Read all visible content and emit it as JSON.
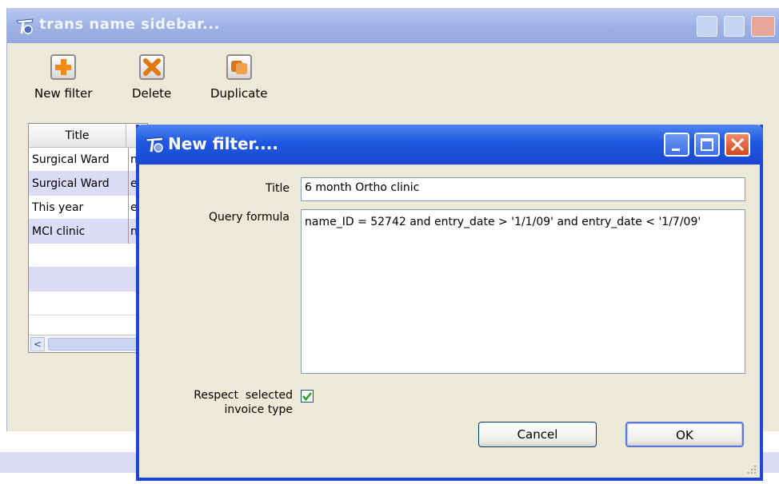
{
  "main_window": {
    "title": "trans name sidebar...",
    "toolbar": {
      "new_filter": "New filter",
      "delete": "Delete",
      "duplicate": "Duplicate"
    },
    "table": {
      "header_title": "Title",
      "rows": [
        {
          "title": "Surgical Ward",
          "col2": "n"
        },
        {
          "title": "Surgical Ward",
          "col2": "e"
        },
        {
          "title": "This year",
          "col2": "e"
        },
        {
          "title": "MCI clinic",
          "col2": "n"
        },
        {
          "title": "",
          "col2": ""
        },
        {
          "title": "",
          "col2": ""
        },
        {
          "title": "",
          "col2": ""
        }
      ],
      "scroll_left_glyph": "<"
    }
  },
  "dialog": {
    "title": "New filter....",
    "title_label": "Title",
    "title_value": "6 month Ortho clinic",
    "query_label": "Query formula",
    "query_value": "name_ID = 52742 and entry_date > '1/1/09' and entry_date < '1/7/09'",
    "respect_label_line1": "Respect  selected",
    "respect_label_line2": "invoice type",
    "respect_checked": true,
    "cancel_label": "Cancel",
    "ok_label": "OK"
  },
  "colors": {
    "dialog_titlebar": "#1f57e0",
    "inactive_titlebar": "#9fb2e6",
    "window_bg": "#ece9d8",
    "row_alt": "#dcdcf8"
  }
}
